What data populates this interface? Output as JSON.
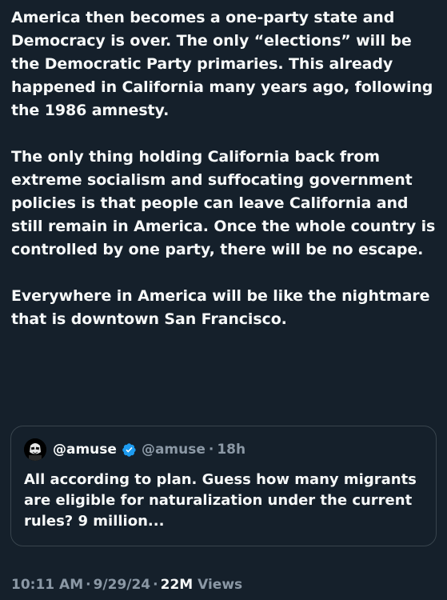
{
  "tweet": {
    "paragraphs": [
      "America then becomes a one-party state and Democracy is over. The only “elections” will be the Democratic Party primaries. This already happened in California many years ago, following the 1986 amnesty.",
      "The only thing holding California back from extreme socialism and suffocating government policies is that people can leave California and still remain in America. Once the whole country is controlled by one party, there will be no escape.",
      "Everywhere in America will be like the nightmare that is downtown San Francisco."
    ],
    "time": "10:11 AM",
    "date": "9/29/24",
    "views_count": "22M",
    "views_label": "Views",
    "separator": "·"
  },
  "quote": {
    "display_name": "@amuse",
    "handle": "@amuse",
    "separator": "·",
    "time": "18h",
    "text": "All according to plan. Guess how many migrants are eligible for naturalization under the current rules? 9 million...",
    "verified_color": "#1d9bf0",
    "avatar_icon": "stormtrooper-avatar-icon",
    "verified_icon": "verified-badge-icon"
  },
  "colors": {
    "background": "#15202b",
    "text": "#f7f9f9",
    "secondary_text": "#8b98a5",
    "border": "#38444d",
    "accent": "#1d9bf0"
  }
}
